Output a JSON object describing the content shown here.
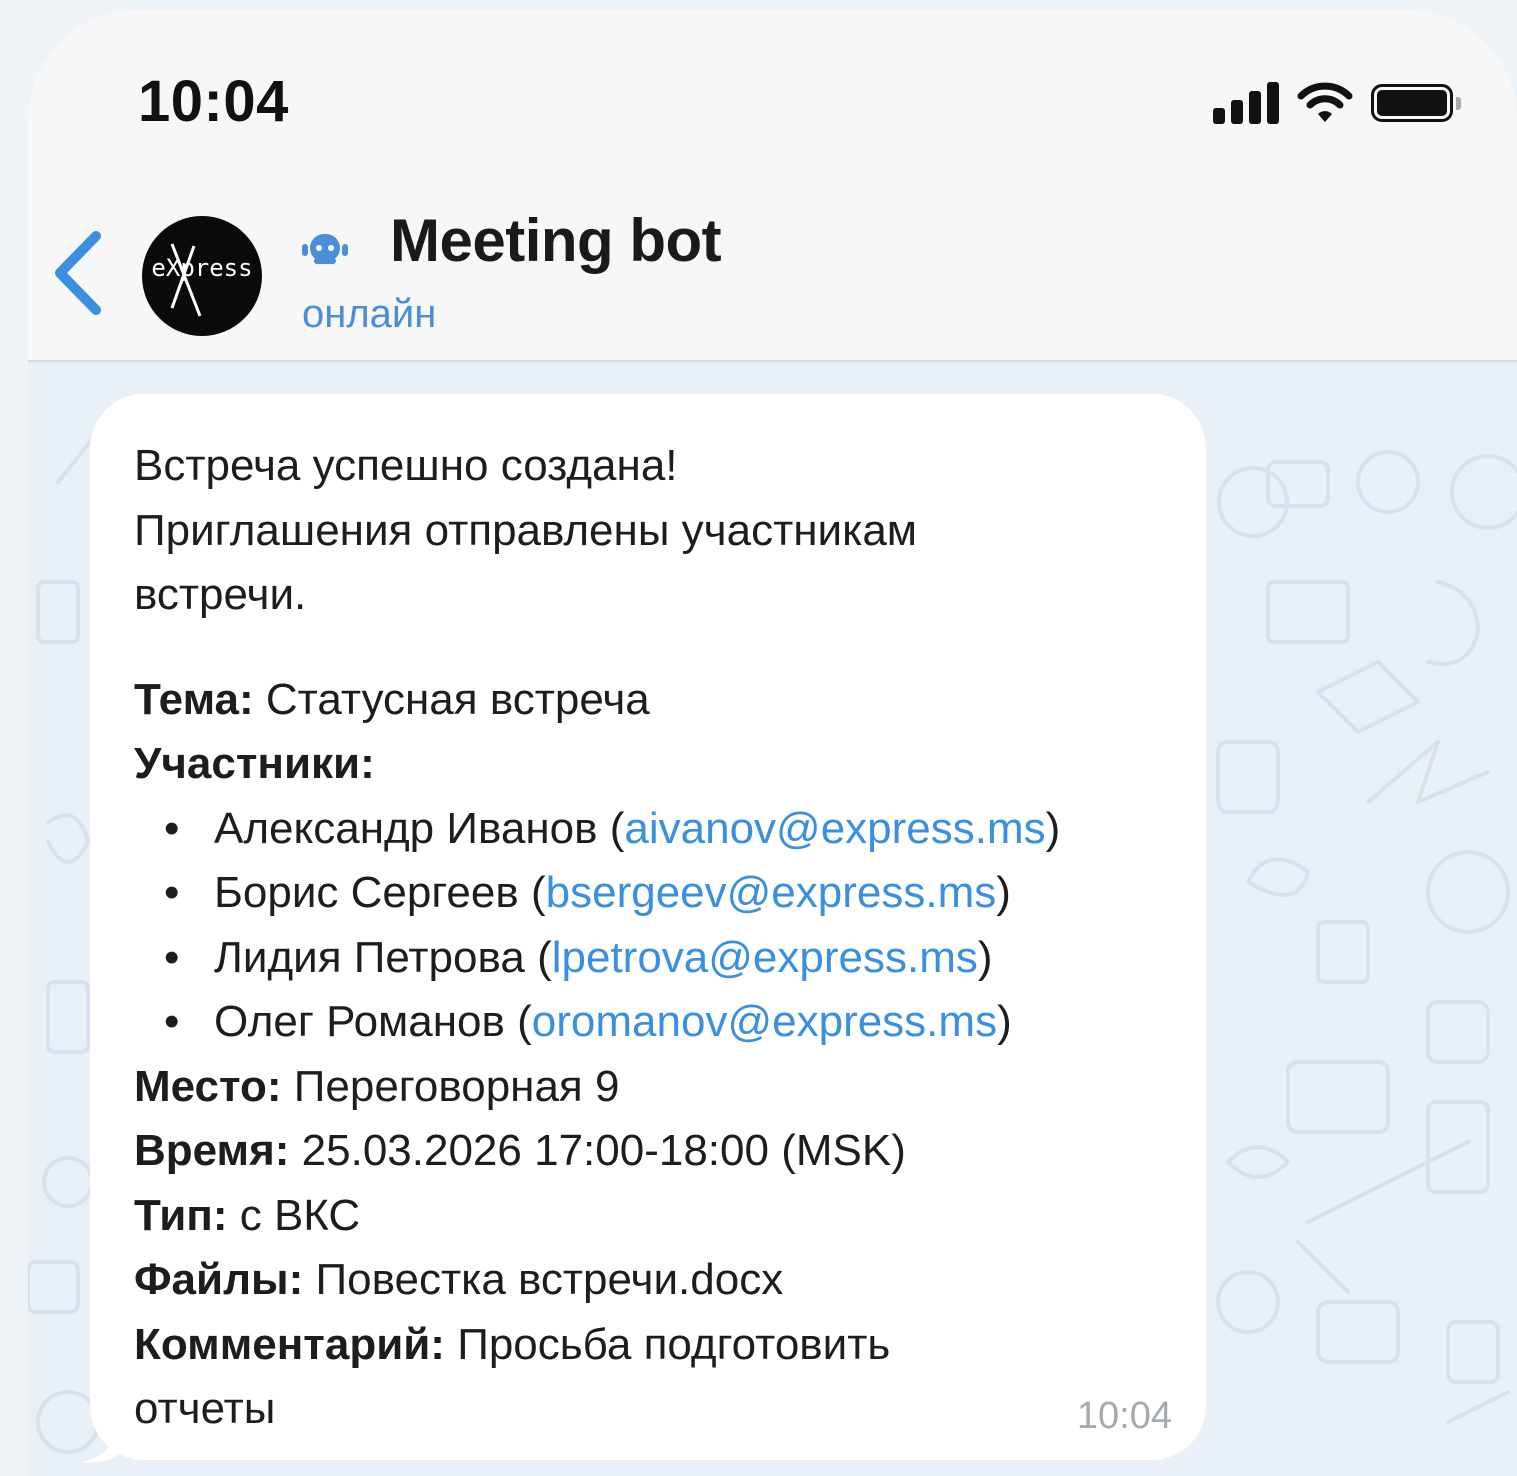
{
  "status_bar": {
    "time": "10:04"
  },
  "header": {
    "avatar_text": "eXpress",
    "title": "Meeting bot",
    "status": "онлайн"
  },
  "message": {
    "intro": [
      "Встреча успешно создана!",
      "Приглашения отправлены участникам",
      "встречи."
    ],
    "topic_label": "Тема:",
    "topic_value": "Статусная встреча",
    "participants_label": "Участники:",
    "participants": [
      {
        "name": "Александр Иванов",
        "email": "aivanov@express.ms"
      },
      {
        "name": "Борис Сергеев",
        "email": "bsergeev@express.ms"
      },
      {
        "name": "Лидия Петрова",
        "email": "lpetrova@express.ms"
      },
      {
        "name": "Олег Романов",
        "email": "oromanov@express.ms"
      }
    ],
    "place_label": "Место:",
    "place_value": "Переговорная 9",
    "time_label": "Время:",
    "time_value": "25.03.2026 17:00-18:00 (MSK)",
    "type_label": "Тип:",
    "type_value": "с ВКС",
    "files_label": "Файлы:",
    "files_value": "Повестка встречи.docx",
    "comment_label": "Комментарий:",
    "comment_value": "Просьба подготовить",
    "comment_value_cont": "отчеты",
    "sent_time": "10:04"
  },
  "colors": {
    "accent": "#3a8fe0",
    "status": "#4a8fd6",
    "bubble": "#ffffff",
    "chat_bg": "#e9f0f7"
  },
  "icons": [
    "back-chevron-icon",
    "bot-icon",
    "signal-icon",
    "wifi-icon",
    "battery-icon"
  ]
}
